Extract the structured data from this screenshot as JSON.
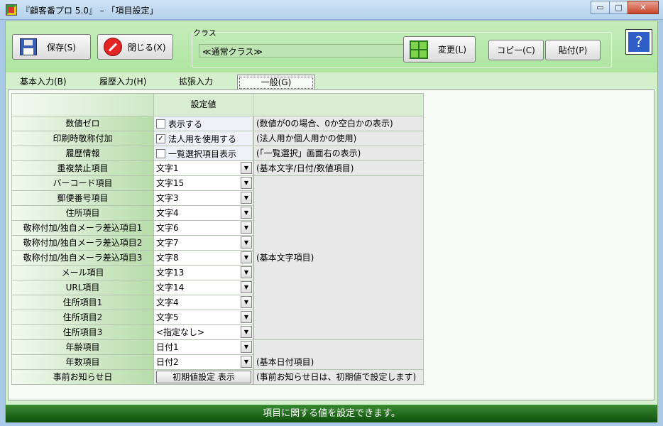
{
  "window": {
    "title": "『顧客番プロ 5.0』 – 「項目設定」",
    "minimize": "▭",
    "maximize": "□",
    "close": "✕"
  },
  "toolbar": {
    "save_label": "保存(S)",
    "close_label": "閉じる(X)",
    "class_group_label": "クラス",
    "class_value": "≪通常クラス≫",
    "change_label": "変更(L)",
    "copy_label": "コピー(C)",
    "paste_label": "貼付(P)",
    "help_glyph": "?"
  },
  "tabs": [
    {
      "label": "基本入力(B)"
    },
    {
      "label": "履歴入力(H)"
    },
    {
      "label": "拡張入力(E)"
    },
    {
      "label": "一般(G)"
    }
  ],
  "table": {
    "header": "設定値",
    "rows": [
      {
        "label": "数値ゼロ",
        "checkbox": "表示する",
        "checked": false,
        "desc": "(数値が0の場合、0か空白かの表示)"
      },
      {
        "label": "印刷時敬称付加",
        "checkbox": "法人用を使用する",
        "checked": true,
        "desc": "(法人用か個人用かの使用)"
      },
      {
        "label": "履歴情報",
        "checkbox": "一覧選択項目表示",
        "checked": false,
        "desc": "(「一覧選択」画面右の表示)"
      },
      {
        "label": "重複禁止項目",
        "select": "文字1",
        "desc": "(基本文字/日付/数値項目)"
      },
      {
        "label": "バーコード項目",
        "select": "文字15"
      },
      {
        "label": "郵便番号項目",
        "select": "文字3"
      },
      {
        "label": "住所項目",
        "select": "文字4"
      },
      {
        "label": "敬称付加/独自メーラ差込項目1",
        "select": "文字6"
      },
      {
        "label": "敬称付加/独自メーラ差込項目2",
        "select": "文字7"
      },
      {
        "label": "敬称付加/独自メーラ差込項目3",
        "select": "文字8",
        "desc": "(基本文字項目)"
      },
      {
        "label": "メール項目",
        "select": "文字13"
      },
      {
        "label": "URL項目",
        "select": "文字14"
      },
      {
        "label": "住所項目1",
        "select": "文字4"
      },
      {
        "label": "住所項目2",
        "select": "文字5"
      },
      {
        "label": "住所項目3",
        "select": "<指定なし>"
      },
      {
        "label": "年齢項目",
        "select": "日付1"
      },
      {
        "label": "年数項目",
        "select": "日付2",
        "desc": "(基本日付項目)"
      },
      {
        "label": "事前お知らせ日",
        "button": "初期値設定 表示",
        "desc": "(事前お知らせ日は、初期値で設定します)"
      }
    ]
  },
  "status_text": "項目に関する値を設定できます。",
  "colors": {
    "panel_green": "#d4efcc",
    "status_green": "#1a5c15",
    "accent_blue": "#2f5fc6"
  }
}
